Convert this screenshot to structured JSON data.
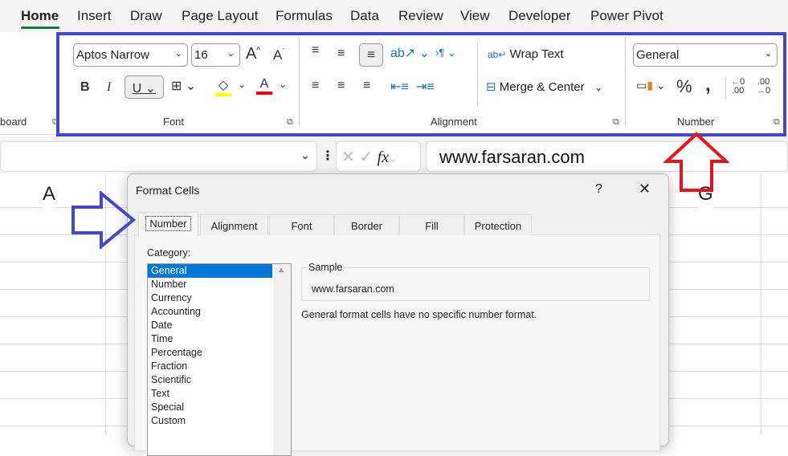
{
  "menu": {
    "tabs": [
      "Home",
      "Insert",
      "Draw",
      "Page Layout",
      "Formulas",
      "Data",
      "Review",
      "View",
      "Developer",
      "Power Pivot"
    ],
    "active": "Home"
  },
  "ribbon": {
    "clipboard_label": "board",
    "font": {
      "name": "Aptos Narrow",
      "size": "16",
      "group_label": "Font",
      "fill_color": "#ffff00",
      "font_color": "#ff0000"
    },
    "alignment": {
      "wrap_text": "Wrap Text",
      "merge_center": "Merge & Center",
      "group_label": "Alignment"
    },
    "number": {
      "format": "General",
      "group_label": "Number"
    }
  },
  "formula_bar": {
    "value": "www.farsaran.com",
    "fx": "fx"
  },
  "columns": [
    "A",
    "G"
  ],
  "dialog": {
    "title": "Format Cells",
    "help": "?",
    "close": "✕",
    "tabs": [
      "Number",
      "Alignment",
      "Font",
      "Border",
      "Fill",
      "Protection"
    ],
    "active_tab": "Number",
    "category_label": "Category:",
    "categories": [
      "General",
      "Number",
      "Currency",
      "Accounting",
      "Date",
      "Time",
      "Percentage",
      "Fraction",
      "Scientific",
      "Text",
      "Special",
      "Custom"
    ],
    "selected_category": "General",
    "sample_label": "Sample",
    "sample_value": "www.farsaran.com",
    "description": "General format cells have no specific number format."
  },
  "annotations": {
    "highlight_color": "#4347c9",
    "arrow_blue": "#4347c9",
    "arrow_red": "#e8141c"
  }
}
